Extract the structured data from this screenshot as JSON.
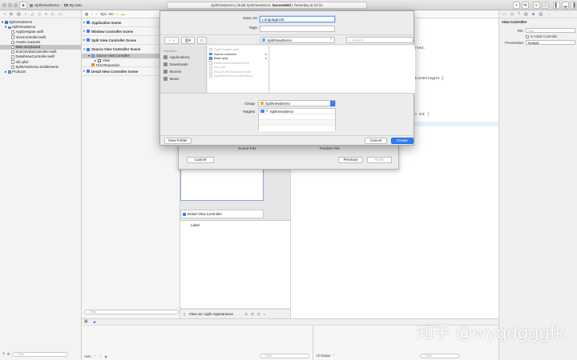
{
  "toolbar": {
    "scheme_name": "SplitViewDemo",
    "device_name": "My Mac",
    "status_prefix": "SplitViewDemo | Build SplitViewDemo:",
    "status_result": "Succeeded",
    "status_suffix": "| Yesterday at 22:31"
  },
  "navigator": {
    "items": [
      {
        "label": "SplitViewDemo",
        "level": 0,
        "icon": "project-icon"
      },
      {
        "label": "SplitViewDemo",
        "level": 1,
        "icon": "folder-icon"
      },
      {
        "label": "AppDelegate.swift",
        "level": 2,
        "icon": "file-icon"
      },
      {
        "label": "ViewController.swift",
        "level": 2,
        "icon": "file-icon"
      },
      {
        "label": "Assets.xcassets",
        "level": 2,
        "icon": "file-icon"
      },
      {
        "label": "Main.storyboard",
        "level": 2,
        "icon": "file-icon",
        "selected": true
      },
      {
        "label": "SourceViewController.swift",
        "level": 2,
        "icon": "file-icon"
      },
      {
        "label": "DetailViewController.swift",
        "level": 2,
        "icon": "file-icon"
      },
      {
        "label": "Info.plist",
        "level": 2,
        "icon": "file-icon"
      },
      {
        "label": "SplitViewDemo.entitlements",
        "level": 2,
        "icon": "file-icon"
      },
      {
        "label": "Products",
        "level": 1,
        "icon": "folder-icon"
      }
    ],
    "filter_placeholder": "Filter"
  },
  "jumpbar": {
    "crumb": "Spl...mo"
  },
  "outline": {
    "scenes": [
      {
        "label": "Application Scene"
      },
      {
        "label": "Window Controller Scene"
      },
      {
        "label": "Split View Controller Scene"
      },
      {
        "label": "Source View Controller Scene"
      }
    ],
    "source_children": [
      {
        "label": "Source View Controller",
        "selected": true,
        "level": 1
      },
      {
        "label": "View",
        "level": 2
      },
      {
        "label": "First Responder",
        "level": 1
      }
    ],
    "detail_scene": "Detail View Controller Scene",
    "filter_placeholder": "Filter"
  },
  "canvas": {
    "vc_label": "Detail View Controller",
    "label_text": "Label",
    "view_as": "View as: Light Appearance"
  },
  "code": {
    "frag_served": "erved.",
    "frag_delegate": "ctionDelegate {",
    "frag_int": "-> Int {"
  },
  "template_sheet": {
    "scene_file": "Scene File",
    "particle_file": "Particle File",
    "cancel": "Cancel",
    "previous": "Previous",
    "finish": "Finish"
  },
  "save_dialog": {
    "save_as_label": "Save As:",
    "save_as_value": "LanguageList",
    "tags_label": "Tags:",
    "location": "SplitViewDemo",
    "search_placeholder": "Search",
    "favorites_heading": "Favorites",
    "favorites": [
      {
        "label": "Applications",
        "icon": "applications-icon"
      },
      {
        "label": "Downloads",
        "icon": "downloads-icon"
      },
      {
        "label": "Movies",
        "icon": "movies-icon"
      },
      {
        "label": "Music",
        "icon": "music-icon"
      }
    ],
    "files": [
      {
        "label": "AppDelegate.swift",
        "enabled": false
      },
      {
        "label": "Assets.xcassets",
        "enabled": true,
        "folder": true
      },
      {
        "label": "Base.lproj",
        "enabled": true,
        "folder": true
      },
      {
        "label": "DetailViewController.swift",
        "enabled": false
      },
      {
        "label": "Info.plist",
        "enabled": false
      },
      {
        "label": "SourceViewController.swift",
        "enabled": false
      },
      {
        "label": "SplitViewDemo.entitlements",
        "enabled": false
      }
    ],
    "group_label": "Group",
    "group_value": "SplitViewDemo",
    "targets_label": "Targets",
    "target_name": "SplitViewDemo",
    "new_folder": "New Folder",
    "cancel": "Cancel",
    "create": "Create"
  },
  "inspector": {
    "section": "View Controller",
    "title_label": "Title",
    "title_placeholder": "Title",
    "initial_controller": "Is Initial Controller",
    "presentation_label": "Presentation",
    "presentation_value": "Multiple"
  },
  "bottom": {
    "auto_label": "Auto",
    "filter_placeholder": "Filter",
    "output_label": "All Output"
  },
  "watermark": "知乎 @wyqdgggfk",
  "colors": {
    "accent": "#2e7cf6",
    "selection": "#c4c4c4"
  }
}
